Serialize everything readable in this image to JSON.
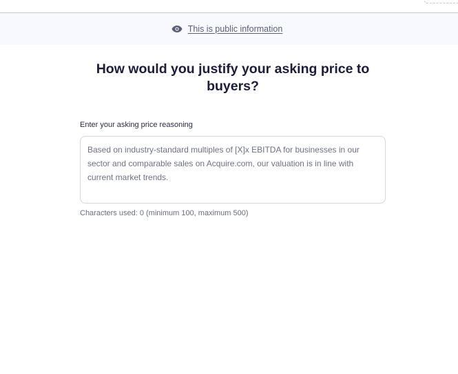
{
  "notice": {
    "link_text": "This is public information",
    "icon": "eye-icon"
  },
  "question": {
    "title": "How would you justify your asking price to buyers?"
  },
  "field": {
    "label": "Enter your asking price reasoning",
    "value": "",
    "placeholder": "Based on industry-standard multiples of [X]x EBITDA for businesses in our sector and comparable sales on Acquire.com, our valuation is in line with current market trends.",
    "counter": "Characters used: 0 (minimum 100, maximum 500)"
  },
  "colors": {
    "heading": "#1c1d3a",
    "notice_bg": "#f8f9fe",
    "muted_text": "#6b6e80"
  }
}
